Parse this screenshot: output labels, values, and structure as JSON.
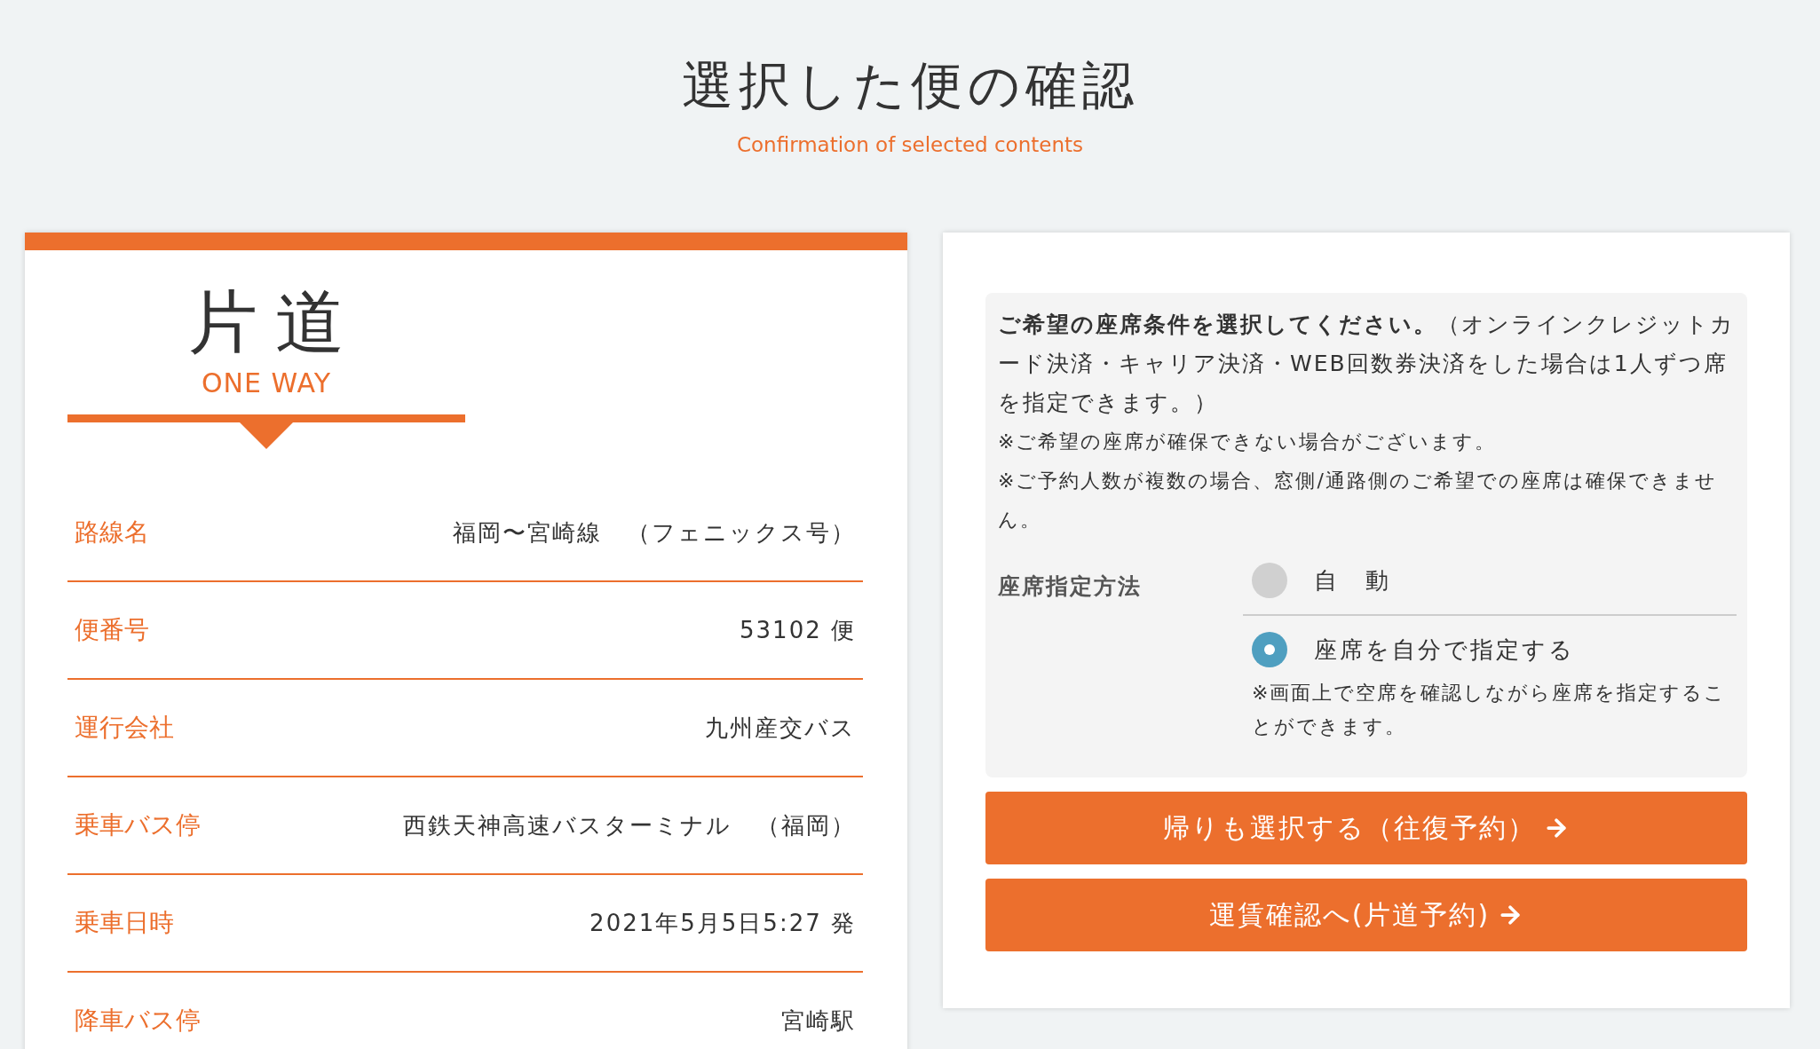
{
  "header": {
    "title": "選択した便の確認",
    "subtitle": "Confirmation of selected contents"
  },
  "trip": {
    "title": "片道",
    "subtitle": "ONE WAY",
    "rows": [
      {
        "label": "路線名",
        "value": "福岡〜宮崎線　（フェニックス号）"
      },
      {
        "label": "便番号",
        "value": "53102 便"
      },
      {
        "label": "運行会社",
        "value": "九州産交バス"
      },
      {
        "label": "乗車バス停",
        "value": "西鉄天神高速バスターミナル　（福岡）"
      },
      {
        "label": "乗車日時",
        "value": "2021年5月5日5:27 発"
      },
      {
        "label": "降車バス停",
        "value": "宮崎駅"
      }
    ]
  },
  "seat": {
    "intro": "**ご希望の座席条件を選択してください。**（オンラインクレジットカード決済・キャリア決済・WEB回数券決済をした場合は1人ずつ席を指定できます。）",
    "notes": [
      "※ご希望の座席が確保できない場合がございます。",
      "※ご予約人数が複数の場合、窓側/通路側のご希望での座席は確保できません。"
    ],
    "method_label": "座席指定方法",
    "options": [
      {
        "label": "自　動",
        "selected": false
      },
      {
        "label": "座席を自分で指定する",
        "selected": true,
        "note": "※画面上で空席を確認しながら座席を指定することができます。"
      }
    ]
  },
  "buttons": [
    {
      "label": "帰りも選択する（往復予約）"
    },
    {
      "label": "運賃確認へ(片道予約)"
    }
  ]
}
